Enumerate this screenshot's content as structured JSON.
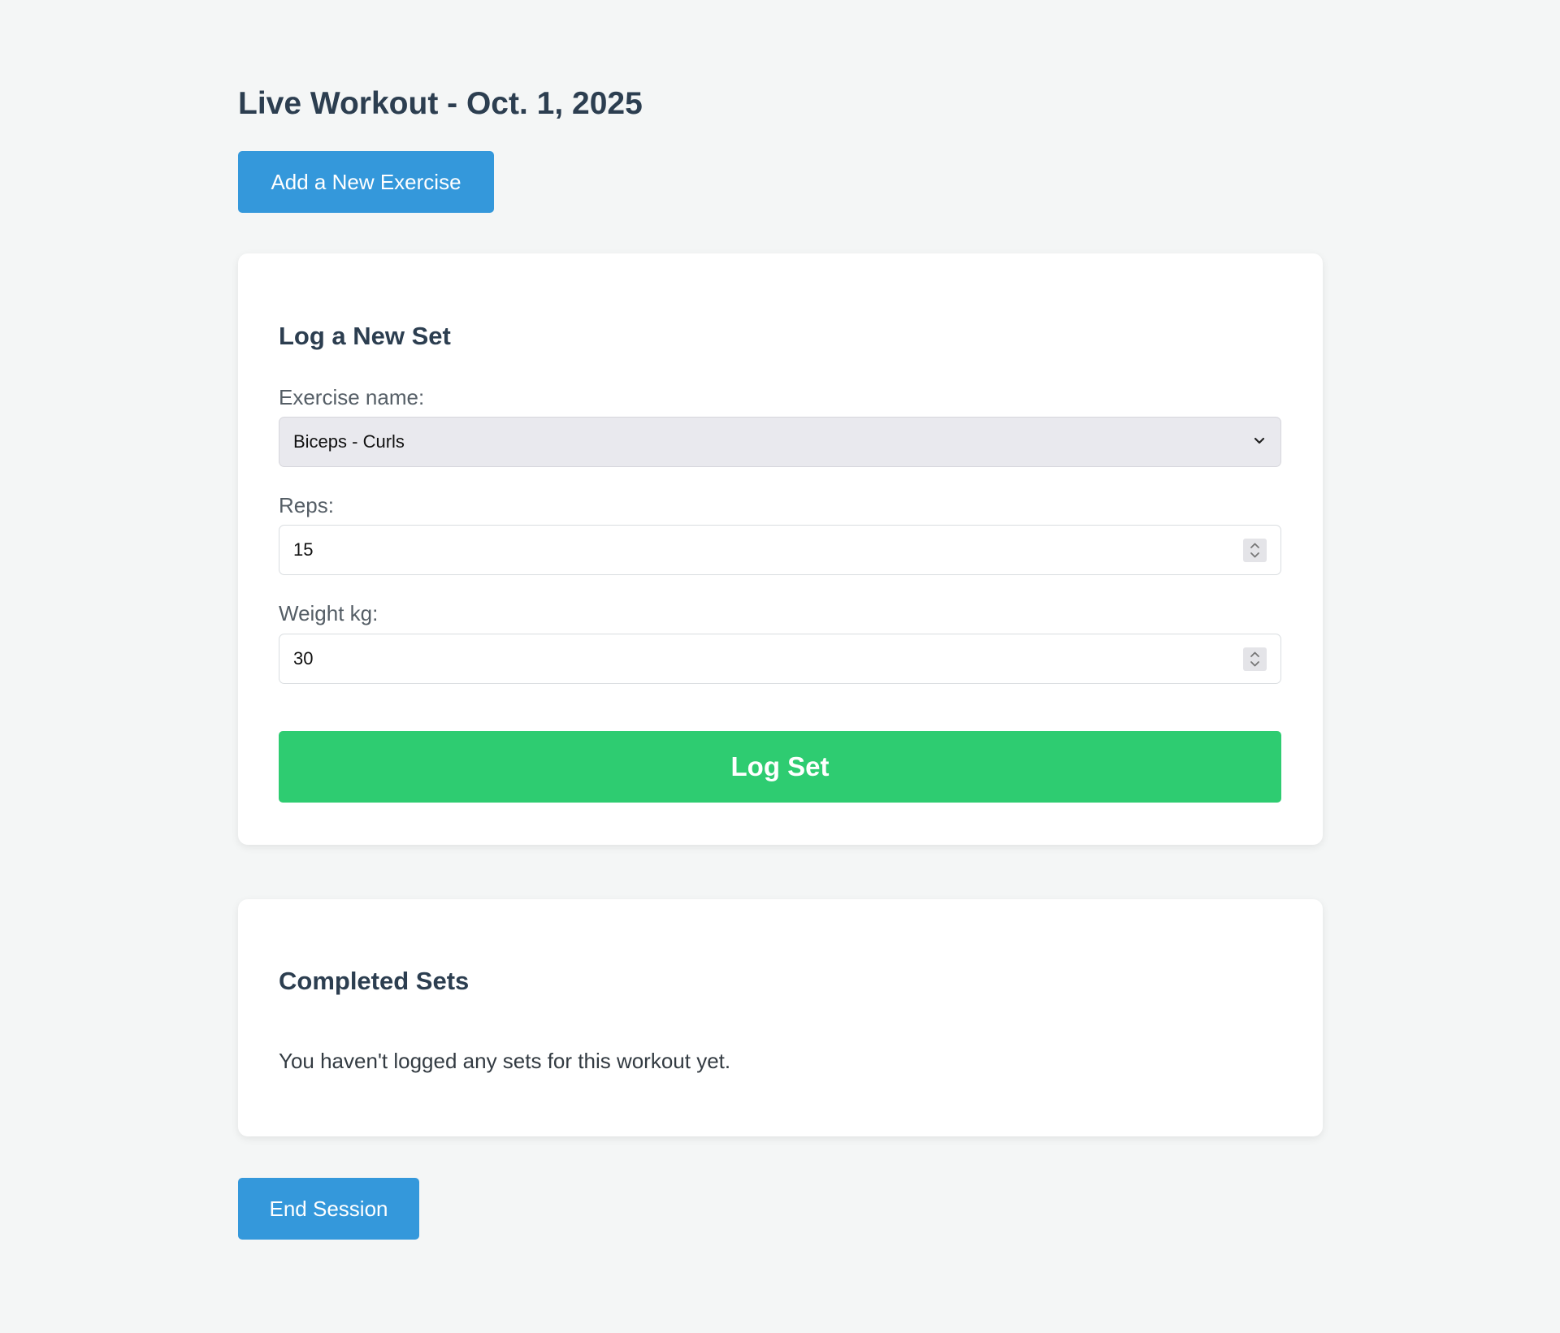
{
  "page": {
    "title": "Live Workout - Oct. 1, 2025"
  },
  "actions": {
    "add_exercise_label": "Add a New Exercise",
    "end_session_label": "End Session"
  },
  "log_set": {
    "title": "Log a New Set",
    "exercise": {
      "label": "Exercise name:",
      "selected": "Biceps - Curls"
    },
    "reps": {
      "label": "Reps:",
      "value": "15"
    },
    "weight": {
      "label": "Weight kg:",
      "value": "30"
    },
    "submit_label": "Log Set"
  },
  "completed_sets": {
    "title": "Completed Sets",
    "empty_message": "You haven't logged any sets for this workout yet."
  },
  "icons": {
    "select_arrow": "chevron-down-icon",
    "number_spinner": "spinner-icon"
  },
  "colors": {
    "primary": "#3498db",
    "success": "#2ecc71",
    "heading": "#2c3e50",
    "background": "#f4f6f6"
  }
}
